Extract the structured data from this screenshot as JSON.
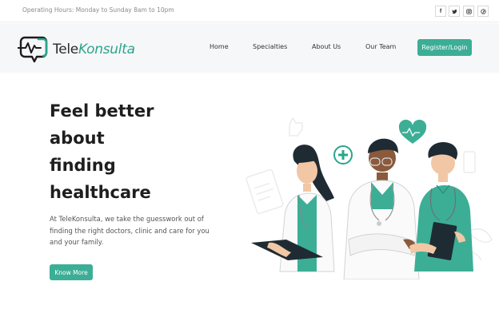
{
  "topbar": {
    "hours": "Operating Hours: Monday to Sunday 8am to 10pm",
    "social": [
      {
        "icon": "facebook-icon",
        "glyph": "f"
      },
      {
        "icon": "twitter-icon",
        "glyph": "t"
      },
      {
        "icon": "instagram-icon",
        "glyph": "o"
      },
      {
        "icon": "pinterest-icon",
        "glyph": "p"
      }
    ]
  },
  "brand": {
    "name_part1": "Tele",
    "name_part2": "Konsulta",
    "accent": "#3cae96"
  },
  "nav": {
    "items": [
      "Home",
      "Specialties",
      "About Us",
      "Our Team"
    ],
    "cta": "Register/Login"
  },
  "hero": {
    "title_lines": [
      "Feel better",
      "about",
      "finding",
      "healthcare"
    ],
    "description": "At TeleKonsulta, we take the guesswork out of finding the right doctors, clinic and care for you and your family.",
    "button": "Know More"
  },
  "illustration": {
    "icon": "three-healthcare-workers-illustration"
  }
}
